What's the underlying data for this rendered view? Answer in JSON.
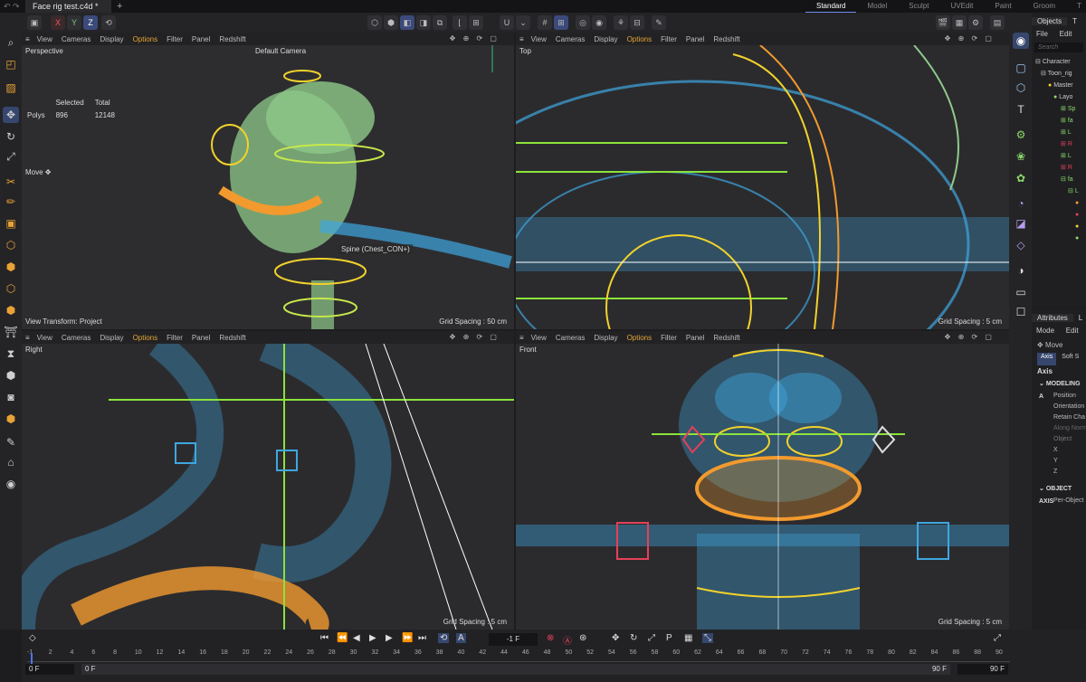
{
  "tab": {
    "title": "Face rig test.c4d *",
    "close": "×",
    "add": "+"
  },
  "layouts": [
    "Standard",
    "Model",
    "Sculpt",
    "UVEdit",
    "Paint",
    "Groom",
    "T"
  ],
  "axis_buttons": {
    "x": "X",
    "y": "Y",
    "z": "Z"
  },
  "viewport_menu": [
    "View",
    "Cameras",
    "Display",
    "Options",
    "Filter",
    "Panel",
    "Redshift"
  ],
  "viewports": {
    "perspective": {
      "label": "Perspective",
      "camera": "Default Camera",
      "grid": "Grid Spacing : 50 cm",
      "view_transform": "View Transform: Project"
    },
    "top": {
      "label": "Top",
      "grid": "Grid Spacing : 5 cm"
    },
    "right": {
      "label": "Right",
      "grid": "Grid Spacing : 5 cm"
    },
    "front": {
      "label": "Front",
      "grid": "Grid Spacing : 5 cm"
    }
  },
  "stats": {
    "selected_label": "Selected",
    "total_label": "Total",
    "polys_label": "Polys",
    "selected": "896",
    "total": "12148"
  },
  "move_label": "Move",
  "tooltip": "Spine (Chest_CON+)",
  "objects_panel": {
    "tabs": [
      "Objects",
      "T"
    ],
    "menu": [
      "File",
      "Edit"
    ],
    "search_placeholder": "Search",
    "tree": [
      "Character",
      "Toon_rig",
      "Master",
      "Layo",
      "Sp",
      "fa",
      "L",
      "R",
      "L",
      "R",
      "fa",
      "L",
      "",
      "",
      "",
      ""
    ]
  },
  "attributes_panel": {
    "tabs": [
      "Attributes",
      "L"
    ],
    "menu": [
      "Mode",
      "Edit"
    ],
    "tool": "Move",
    "subtabs": [
      "Axis",
      "Soft S"
    ],
    "section": "Axis",
    "modeling_header": "MODELING A",
    "modeling_rows": [
      "Position",
      "Orientation",
      "Retain Cha",
      "Along Norm",
      "Object",
      "X",
      "Y",
      "Z"
    ],
    "object_axis_header": "OBJECT AXIS",
    "object_axis_rows": [
      "Per-Object"
    ]
  },
  "timeline": {
    "current_frame": "-1 F",
    "ruler": [
      "-1",
      "2",
      "4",
      "6",
      "8",
      "10",
      "12",
      "14",
      "16",
      "18",
      "20",
      "22",
      "24",
      "26",
      "28",
      "30",
      "32",
      "34",
      "36",
      "38",
      "40",
      "42",
      "44",
      "46",
      "48",
      "50",
      "52",
      "54",
      "56",
      "58",
      "60",
      "62",
      "64",
      "66",
      "68",
      "70",
      "72",
      "74",
      "76",
      "78",
      "80",
      "82",
      "84",
      "86",
      "88",
      "90"
    ],
    "start": "0 F",
    "preview_start": "0 F",
    "preview_end": "90 F",
    "end": "90 F"
  },
  "colors": {
    "accent": "#36466e",
    "options": "#e5a633",
    "mesh": "#3fa7e0",
    "rig_yellow": "#f2d22b",
    "mouth_orange": "#f29a2e",
    "body_green": "#8fc98a"
  }
}
